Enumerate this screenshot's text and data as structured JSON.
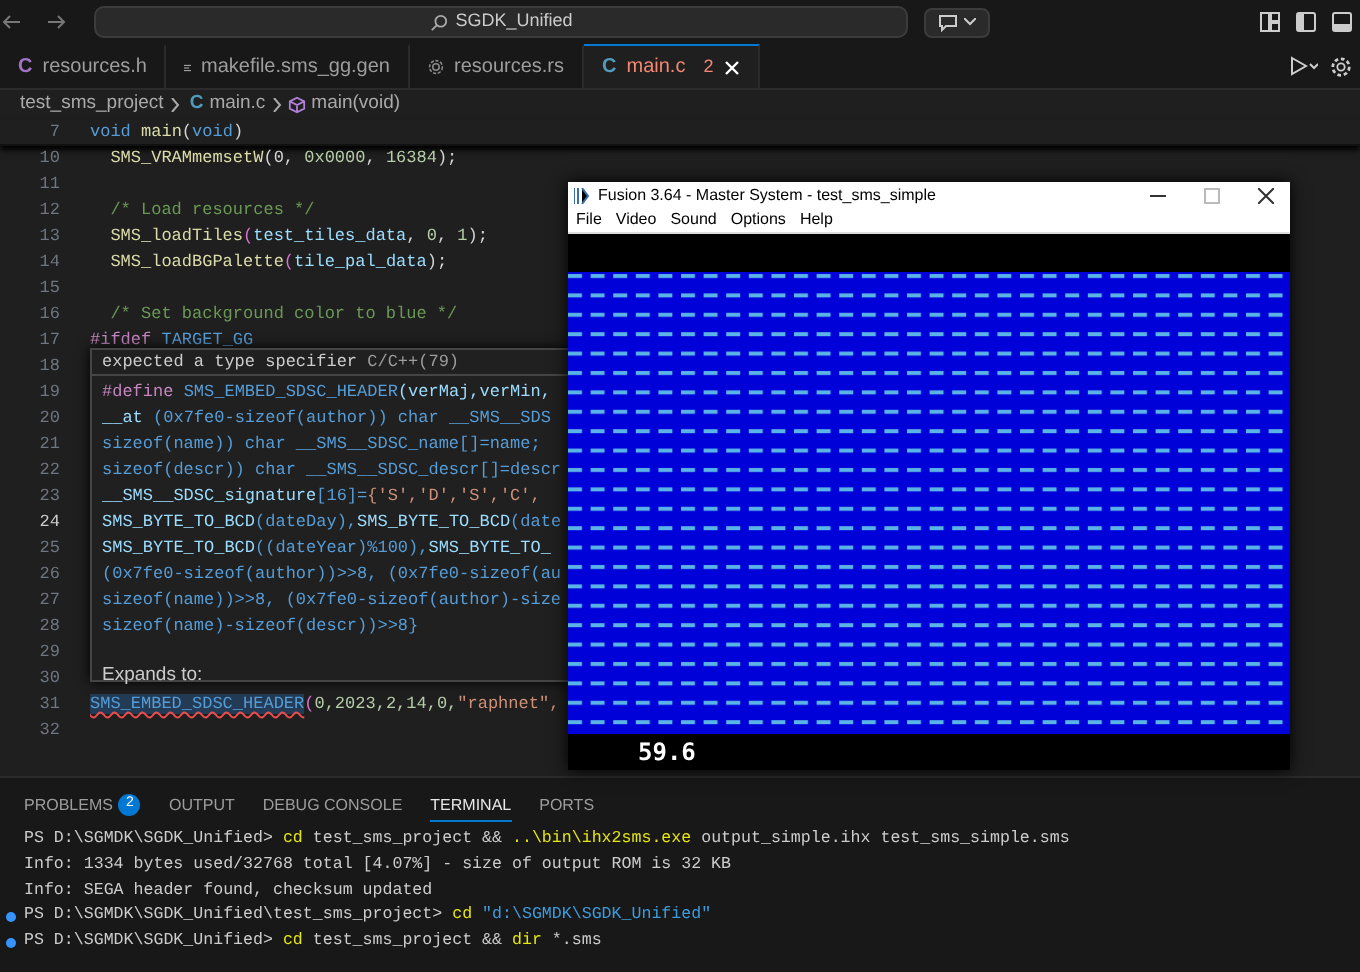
{
  "title_bar": {
    "search": "SGDK_Unified"
  },
  "tabs": [
    {
      "label": "resources.h",
      "kind": "header",
      "icon": "C",
      "selected": false
    },
    {
      "label": "makefile.sms_gg.gen",
      "kind": "makefile",
      "selected": false
    },
    {
      "label": "resources.rs",
      "kind": "rust",
      "selected": false
    },
    {
      "label": "main.c",
      "kind": "c",
      "icon": "C",
      "selected": true,
      "problems": "2"
    }
  ],
  "breadcrumb": [
    {
      "label": "test_sms_project",
      "kind": "folder"
    },
    {
      "label": "main.c",
      "kind": "c",
      "icon": "C"
    },
    {
      "label": "main(void)",
      "kind": "function"
    }
  ],
  "sticky_line": {
    "number": "7",
    "tokens": [
      {
        "text": "void ",
        "kind": "kw"
      },
      {
        "text": "main",
        "kind": "fn"
      },
      {
        "text": "(",
        "kind": "punc"
      },
      {
        "text": "void",
        "kind": "kw"
      },
      {
        "text": ")",
        "kind": "punc"
      }
    ]
  },
  "lines": [
    {
      "number": "10",
      "current": false,
      "tokens": [
        {
          "text": "  SMS_VRAMmemsetW",
          "kind": "fn"
        },
        {
          "text": "(0, ",
          "kind": "punc"
        },
        {
          "text": "0x0000",
          "kind": "num"
        },
        {
          "text": ", ",
          "kind": "punc"
        },
        {
          "text": "16384",
          "kind": "num"
        },
        {
          "text": ");",
          "kind": "punc"
        }
      ]
    },
    {
      "number": "11",
      "current": false
    },
    {
      "number": "12",
      "current": false,
      "tokens": [
        {
          "text": "  /* Load resources */",
          "kind": "com"
        }
      ]
    },
    {
      "number": "13",
      "current": false,
      "tokens": [
        {
          "text": "  SMS_loadTiles",
          "kind": "fn"
        },
        {
          "text": "(",
          "kind": "paren"
        },
        {
          "text": "test_tiles_data",
          "kind": "var"
        },
        {
          "text": ", ",
          "kind": "punc"
        },
        {
          "text": "0",
          "kind": "num"
        },
        {
          "text": ", ",
          "kind": "punc"
        },
        {
          "text": "1",
          "kind": "num"
        },
        {
          "text": ");",
          "kind": "punc"
        }
      ]
    },
    {
      "number": "14",
      "current": false,
      "tokens": [
        {
          "text": "  SMS_loadBGPalette",
          "kind": "fn"
        },
        {
          "text": "(",
          "kind": "paren"
        },
        {
          "text": "tile_pal_data",
          "kind": "var"
        },
        {
          "text": ");",
          "kind": "punc"
        }
      ]
    },
    {
      "number": "15",
      "current": false
    },
    {
      "number": "16",
      "current": false,
      "tokens": [
        {
          "text": "  /* Set background color to blue */",
          "kind": "com"
        }
      ]
    },
    {
      "number": "17",
      "current": false,
      "tokens": [
        {
          "text": "#ifdef ",
          "kind": "pre"
        },
        {
          "text": "TARGET_GG",
          "kind": "macro"
        }
      ]
    },
    {
      "number": "18",
      "current": false
    },
    {
      "number": "19",
      "current": false
    },
    {
      "number": "20",
      "current": false
    },
    {
      "number": "21",
      "current": false
    },
    {
      "number": "22",
      "current": false
    },
    {
      "number": "23",
      "current": false
    },
    {
      "number": "24",
      "current": true
    },
    {
      "number": "25",
      "current": false
    },
    {
      "number": "26",
      "current": false
    },
    {
      "number": "27",
      "current": false
    },
    {
      "number": "28",
      "current": false
    },
    {
      "number": "29",
      "current": false
    },
    {
      "number": "30",
      "current": false
    },
    {
      "number": "31",
      "current": false,
      "tokens": [
        {
          "text": "SMS_EMBED_SDSC_HEADER",
          "kind": "error"
        },
        {
          "text": "(",
          "kind": "paren"
        },
        {
          "text": "0,2023,2,14,0,",
          "kind": "num"
        },
        {
          "text": "\"raphnet\",",
          "kind": "str"
        }
      ]
    },
    {
      "number": "32",
      "current": false
    }
  ],
  "hover": {
    "message": "expected a type specifier",
    "source": "C/C++(79)",
    "definition": [
      [
        {
          "text": "#define ",
          "kind": "pre"
        },
        {
          "text": "SMS_EMBED_SDSC_HEADER",
          "kind": "macro"
        },
        {
          "text": "(verMaj,verMin,",
          "kind": "var"
        }
      ],
      [
        {
          "text": "__at ",
          "kind": "var"
        },
        {
          "text": "(0x7fe0-sizeof(author)) char __SMS__SDS",
          "kind": "macro"
        }
      ],
      [
        {
          "text": "sizeof(name)) char __SMS__SDSC_name[]=name;",
          "kind": "macro"
        }
      ],
      [
        {
          "text": "sizeof(descr)) char __SMS__SDSC_descr[]=descr",
          "kind": "macro"
        }
      ],
      [
        {
          "text": "__SMS__SDSC_signature",
          "kind": "var"
        },
        {
          "text": "[16]=",
          "kind": "macro"
        },
        {
          "text": "{'S','D','S','C',",
          "kind": "str"
        }
      ],
      [
        {
          "text": "SMS_BYTE_TO_BCD",
          "kind": "var"
        },
        {
          "text": "(dateDay),",
          "kind": "macro"
        },
        {
          "text": "SMS_BYTE_TO_BCD",
          "kind": "var"
        },
        {
          "text": "(date",
          "kind": "macro"
        }
      ],
      [
        {
          "text": "SMS_BYTE_TO_BCD",
          "kind": "var"
        },
        {
          "text": "((dateYear)%100),",
          "kind": "macro"
        },
        {
          "text": "SMS_BYTE_TO_",
          "kind": "var"
        }
      ],
      [
        {
          "text": "(0x7fe0-sizeof(author))>>8, (0x7fe0-sizeof(au",
          "kind": "macro"
        }
      ],
      [
        {
          "text": "sizeof(name))>>8, (0x7fe0-sizeof(author)-size",
          "kind": "macro"
        }
      ],
      [
        {
          "text": "sizeof(name)-sizeof(descr))>>8}",
          "kind": "macro"
        }
      ]
    ],
    "expands": "Expands to:"
  },
  "emulator": {
    "title": "Fusion 3.64 - Master System - test_sms_simple",
    "menu": [
      "File",
      "Video",
      "Sound",
      "Options",
      "Help"
    ],
    "fps": "59.6"
  },
  "panel": {
    "tabs": [
      {
        "label": "PROBLEMS",
        "badge": "2",
        "selected": false
      },
      {
        "label": "OUTPUT",
        "selected": false
      },
      {
        "label": "DEBUG CONSOLE",
        "selected": false
      },
      {
        "label": "TERMINAL",
        "selected": true
      },
      {
        "label": "PORTS",
        "selected": false
      }
    ],
    "terminal": [
      {
        "marker": false,
        "tokens": [
          {
            "text": "PS D:\\SGMDK\\SGDK_Unified> ",
            "kind": "plain"
          },
          {
            "text": "cd ",
            "kind": "cmd"
          },
          {
            "text": "test_sms_project && ",
            "kind": "plain"
          },
          {
            "text": "..\\bin\\ihx2sms.exe ",
            "kind": "cmd"
          },
          {
            "text": "output_simple.ihx test_sms_simple.sms",
            "kind": "plain"
          }
        ]
      },
      {
        "marker": false,
        "tokens": [
          {
            "text": "Info: 1334 bytes used/32768 total [4.07%] - size of output ROM is 32 KB",
            "kind": "plain"
          }
        ]
      },
      {
        "marker": false,
        "tokens": [
          {
            "text": "Info: SEGA header found, checksum updated",
            "kind": "plain"
          }
        ]
      },
      {
        "marker": true,
        "tokens": [
          {
            "text": "PS D:\\SGMDK\\SGDK_Unified\\test_sms_project> ",
            "kind": "plain"
          },
          {
            "text": "cd ",
            "kind": "cmd"
          },
          {
            "text": "\"d:\\SGMDK\\SGDK_Unified\"",
            "kind": "path"
          }
        ]
      },
      {
        "marker": true,
        "tokens": [
          {
            "text": "PS D:\\SGMDK\\SGDK_Unified> ",
            "kind": "plain"
          },
          {
            "text": "cd ",
            "kind": "cmd"
          },
          {
            "text": "test_sms_project && ",
            "kind": "plain"
          },
          {
            "text": "dir ",
            "kind": "cmd"
          },
          {
            "text": "*.sms",
            "kind": "plain"
          }
        ]
      }
    ]
  }
}
